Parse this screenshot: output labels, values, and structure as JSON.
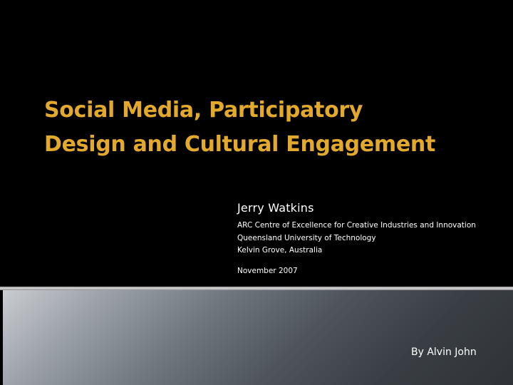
{
  "slide": {
    "title_lines": [
      "Social Media, Participatory",
      "Design and Cultural Engagement"
    ],
    "presenter": "Jerry Watkins",
    "affiliation_lines": [
      "ARC Centre of Excellence for Creative Industries and Innovation",
      "Queensland University of Technology",
      "Kelvin Grove, Australia"
    ],
    "date": "November 2007",
    "byline": "By Alvin John"
  },
  "colors": {
    "background": "#000000",
    "title": "#e2a92c",
    "text": "#ffffff"
  }
}
